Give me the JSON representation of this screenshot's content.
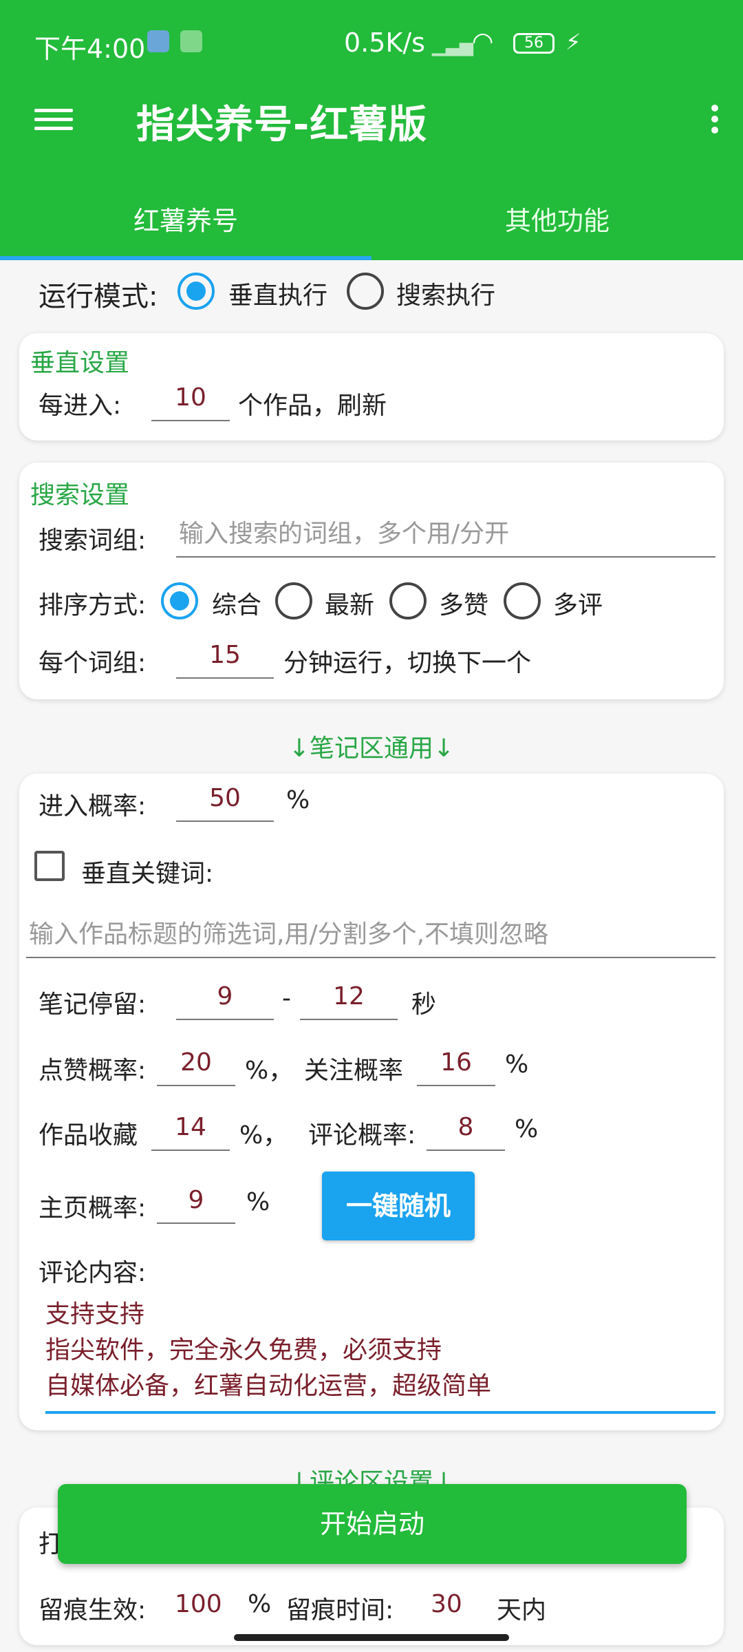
{
  "status": {
    "time": "下午4:00",
    "speed": "0.5K/s",
    "battery": "56"
  },
  "app": {
    "title": "指尖养号-红薯版"
  },
  "tabs": [
    {
      "label": "红薯养号"
    },
    {
      "label": "其他功能"
    }
  ],
  "run_mode": {
    "label": "运行模式:",
    "options": [
      "垂直执行",
      "搜索执行"
    ],
    "selected": "垂直执行"
  },
  "vertical": {
    "title": "垂直设置",
    "prefix": "每进入:",
    "value": "10",
    "suffix": "个作品，刷新"
  },
  "search": {
    "title": "搜索设置",
    "words_label": "搜索词组:",
    "words_placeholder": "输入搜索的词组，多个用/分开",
    "sort_label": "排序方式:",
    "sort_options": [
      "综合",
      "最新",
      "多赞",
      "多评"
    ],
    "sort_selected": "综合",
    "per_label": "每个词组:",
    "per_value": "15",
    "per_suffix": "分钟运行，切换下一个"
  },
  "notes": {
    "header": "↓笔记区通用↓",
    "enter_label": "进入概率:",
    "enter_value": "50",
    "percent": "%",
    "keyword_label": "垂直关键词:",
    "keyword_placeholder": "输入作品标题的筛选词,用/分割多个,不填则忽略",
    "stay_label": "笔记停留:",
    "stay_min": "9",
    "dash": "-",
    "stay_max": "12",
    "seconds": "秒",
    "like_label": "点赞概率:",
    "like_value": "20",
    "comma": "%，",
    "follow_label": "关注概率",
    "follow_value": "16",
    "collect_label": "作品收藏",
    "collect_value": "14",
    "comma2": "%，",
    "comment_label": "评论概率:",
    "comment_value": "8",
    "home_label": "主页概率:",
    "home_value": "9",
    "random_button": "一键随机",
    "content_label": "评论内容:",
    "content_lines": [
      "支持支持",
      "指尖软件，完全永久免费，必须支持",
      "自媒体必备，红薯自动化运营，超级简单"
    ]
  },
  "comment_section": {
    "header": "↓评论区设置↓",
    "row1_label": "打",
    "row2_label1": "留痕生效:",
    "row2_value1": "100",
    "row2_label2": "留痕时间:",
    "row2_value2": "30",
    "row2_suffix": "天内"
  },
  "start_button": "开始启动",
  "colors": {
    "primary": "#22bb3a",
    "accent": "#1aa3ef",
    "section": "#28a745"
  }
}
